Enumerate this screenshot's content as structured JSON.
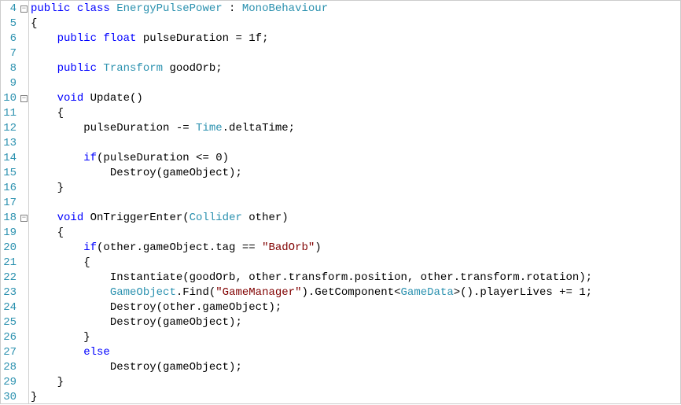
{
  "lines": [
    {
      "num": 4,
      "fold": "-",
      "tokens": [
        [
          "kw",
          "public "
        ],
        [
          "kw",
          "class "
        ],
        [
          "type",
          "EnergyPulsePower"
        ],
        [
          "txt",
          " : "
        ],
        [
          "type",
          "MonoBehaviour"
        ]
      ]
    },
    {
      "num": 5,
      "fold": "",
      "tokens": [
        [
          "txt",
          "{"
        ]
      ]
    },
    {
      "num": 6,
      "fold": "",
      "tokens": [
        [
          "txt",
          "    "
        ],
        [
          "kw",
          "public "
        ],
        [
          "kw",
          "float "
        ],
        [
          "txt",
          "pulseDuration = 1f;"
        ]
      ]
    },
    {
      "num": 7,
      "fold": "",
      "tokens": []
    },
    {
      "num": 8,
      "fold": "",
      "tokens": [
        [
          "txt",
          "    "
        ],
        [
          "kw",
          "public "
        ],
        [
          "type",
          "Transform"
        ],
        [
          "txt",
          " goodOrb;"
        ]
      ]
    },
    {
      "num": 9,
      "fold": "",
      "tokens": []
    },
    {
      "num": 10,
      "fold": "-",
      "tokens": [
        [
          "txt",
          "    "
        ],
        [
          "kw",
          "void "
        ],
        [
          "txt",
          "Update()"
        ]
      ]
    },
    {
      "num": 11,
      "fold": "",
      "tokens": [
        [
          "txt",
          "    {"
        ]
      ]
    },
    {
      "num": 12,
      "fold": "",
      "tokens": [
        [
          "txt",
          "        pulseDuration -= "
        ],
        [
          "type",
          "Time"
        ],
        [
          "txt",
          ".deltaTime;"
        ]
      ]
    },
    {
      "num": 13,
      "fold": "",
      "tokens": []
    },
    {
      "num": 14,
      "fold": "",
      "tokens": [
        [
          "txt",
          "        "
        ],
        [
          "kw",
          "if"
        ],
        [
          "txt",
          "(pulseDuration <= 0)"
        ]
      ]
    },
    {
      "num": 15,
      "fold": "",
      "tokens": [
        [
          "txt",
          "            Destroy(gameObject);"
        ]
      ]
    },
    {
      "num": 16,
      "fold": "",
      "tokens": [
        [
          "txt",
          "    }"
        ]
      ]
    },
    {
      "num": 17,
      "fold": "",
      "tokens": []
    },
    {
      "num": 18,
      "fold": "-",
      "tokens": [
        [
          "txt",
          "    "
        ],
        [
          "kw",
          "void "
        ],
        [
          "txt",
          "OnTriggerEnter("
        ],
        [
          "type",
          "Collider"
        ],
        [
          "txt",
          " other)"
        ]
      ]
    },
    {
      "num": 19,
      "fold": "",
      "tokens": [
        [
          "txt",
          "    {"
        ]
      ]
    },
    {
      "num": 20,
      "fold": "",
      "tokens": [
        [
          "txt",
          "        "
        ],
        [
          "kw",
          "if"
        ],
        [
          "txt",
          "(other.gameObject.tag == "
        ],
        [
          "str",
          "\"BadOrb\""
        ],
        [
          "txt",
          ")"
        ]
      ]
    },
    {
      "num": 21,
      "fold": "",
      "tokens": [
        [
          "txt",
          "        {"
        ]
      ]
    },
    {
      "num": 22,
      "fold": "",
      "tokens": [
        [
          "txt",
          "            Instantiate(goodOrb, other.transform.position, other.transform.rotation);"
        ]
      ]
    },
    {
      "num": 23,
      "fold": "",
      "tokens": [
        [
          "txt",
          "            "
        ],
        [
          "type",
          "GameObject"
        ],
        [
          "txt",
          ".Find("
        ],
        [
          "str",
          "\"GameManager\""
        ],
        [
          "txt",
          ").GetComponent<"
        ],
        [
          "type",
          "GameData"
        ],
        [
          "txt",
          ">().playerLives += 1;"
        ]
      ]
    },
    {
      "num": 24,
      "fold": "",
      "tokens": [
        [
          "txt",
          "            Destroy(other.gameObject);"
        ]
      ]
    },
    {
      "num": 25,
      "fold": "",
      "tokens": [
        [
          "txt",
          "            Destroy(gameObject);"
        ]
      ]
    },
    {
      "num": 26,
      "fold": "",
      "tokens": [
        [
          "txt",
          "        }"
        ]
      ]
    },
    {
      "num": 27,
      "fold": "",
      "tokens": [
        [
          "txt",
          "        "
        ],
        [
          "kw",
          "else"
        ]
      ]
    },
    {
      "num": 28,
      "fold": "",
      "tokens": [
        [
          "txt",
          "            Destroy(gameObject);"
        ]
      ]
    },
    {
      "num": 29,
      "fold": "",
      "tokens": [
        [
          "txt",
          "    }"
        ]
      ]
    },
    {
      "num": 30,
      "fold": "",
      "tokens": [
        [
          "txt",
          "}"
        ]
      ]
    }
  ],
  "fold_symbol": "−"
}
